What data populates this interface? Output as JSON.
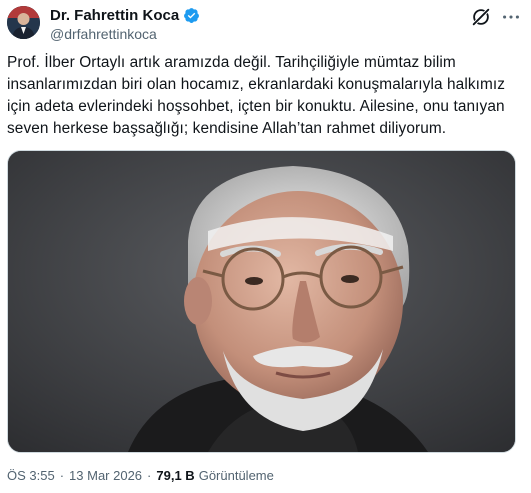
{
  "author": {
    "display_name": "Dr. Fahrettin Koca",
    "handle": "@drfahrettinkoca",
    "verified_icon": "verified-badge-icon"
  },
  "tweet": {
    "text": "Prof. İlber Ortaylı artık aramızda değil. Tarihçiliğiyle mümtaz bilim insanlarımızdan biri olan hocamız, ekranlardaki konuşmalarıyla halkımız için adeta evlerindeki hoşsohbet, içten bir konuktu. Ailesine, onu tanıyan seven herkese başsağlığı; kendisine Allah’tan rahmet diliyorum."
  },
  "meta": {
    "time": "ÖS 3:55",
    "separator": "·",
    "date": "13 Mar 2026",
    "views_count": "79,1 B",
    "views_label": "Görüntüleme"
  },
  "colors": {
    "verified": "#1d9bf0",
    "text": "#0f1419",
    "secondary": "#536471",
    "border": "#cfd9de"
  },
  "icons": {
    "grok": "grok-icon",
    "more": "more-icon"
  }
}
